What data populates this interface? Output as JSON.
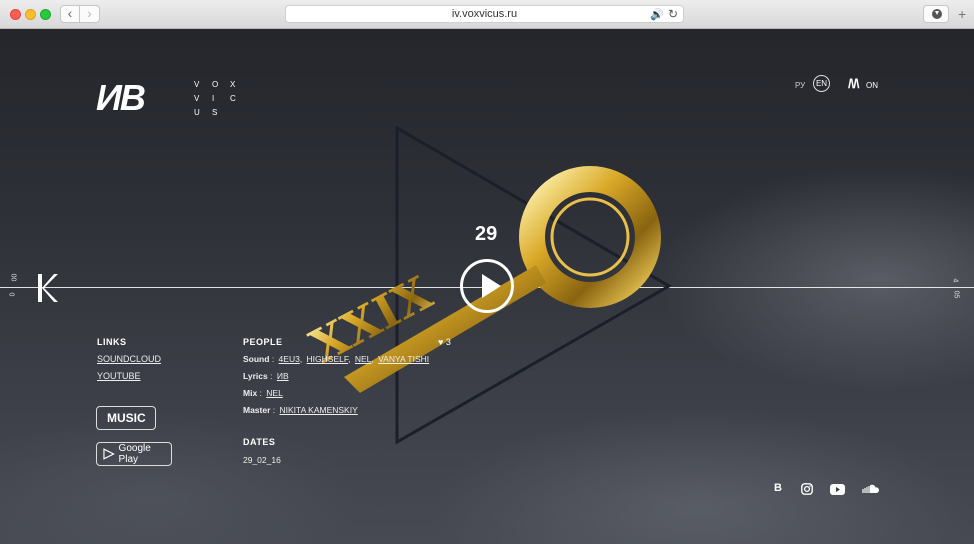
{
  "browser": {
    "url": "iv.voxvicus.ru",
    "back_glyph": "‹",
    "forward_glyph": "›",
    "new_tab_glyph": "+"
  },
  "brand": {
    "logo": "ИB",
    "vox_rows": [
      [
        "V",
        "O",
        "X"
      ],
      [
        "V",
        "I",
        "C"
      ],
      [
        "U",
        "S",
        ""
      ]
    ]
  },
  "language": {
    "ru": "РУ",
    "en": "EN"
  },
  "sound": {
    "wave": "/\\/\\",
    "state": "ON"
  },
  "timeline": {
    "left_top": "00",
    "left_bottom": "0",
    "right_top": "4",
    "right_bottom": "05"
  },
  "track": {
    "number": "29",
    "title_art": "XXIX",
    "likes": "3",
    "heart": "♥"
  },
  "links": {
    "heading": "LINKS",
    "items": [
      "SOUNDCLOUD",
      "YOUTUBE"
    ]
  },
  "stores": {
    "apple_music": "MUSIC",
    "apple_glyph": "",
    "google_play": "Google Play"
  },
  "people": {
    "heading": "PEOPLE",
    "rows": [
      {
        "role": "Sound",
        "names": [
          "4EU3",
          "HIGHSELF",
          "NEL",
          "VANYA TISHI"
        ]
      },
      {
        "role": "Lyrics",
        "names": [
          "ИB"
        ]
      },
      {
        "role": "Mix",
        "names": [
          "NEL"
        ]
      },
      {
        "role": "Master",
        "names": [
          "NIKITA KAMENSKIY"
        ]
      }
    ]
  },
  "dates": {
    "heading": "DATES",
    "value": "29_02_16"
  },
  "social": {
    "vk": "B"
  },
  "colors": {
    "accent_gold": "#c9a227",
    "background_top": "#24262c",
    "background_bottom": "#474a52"
  }
}
